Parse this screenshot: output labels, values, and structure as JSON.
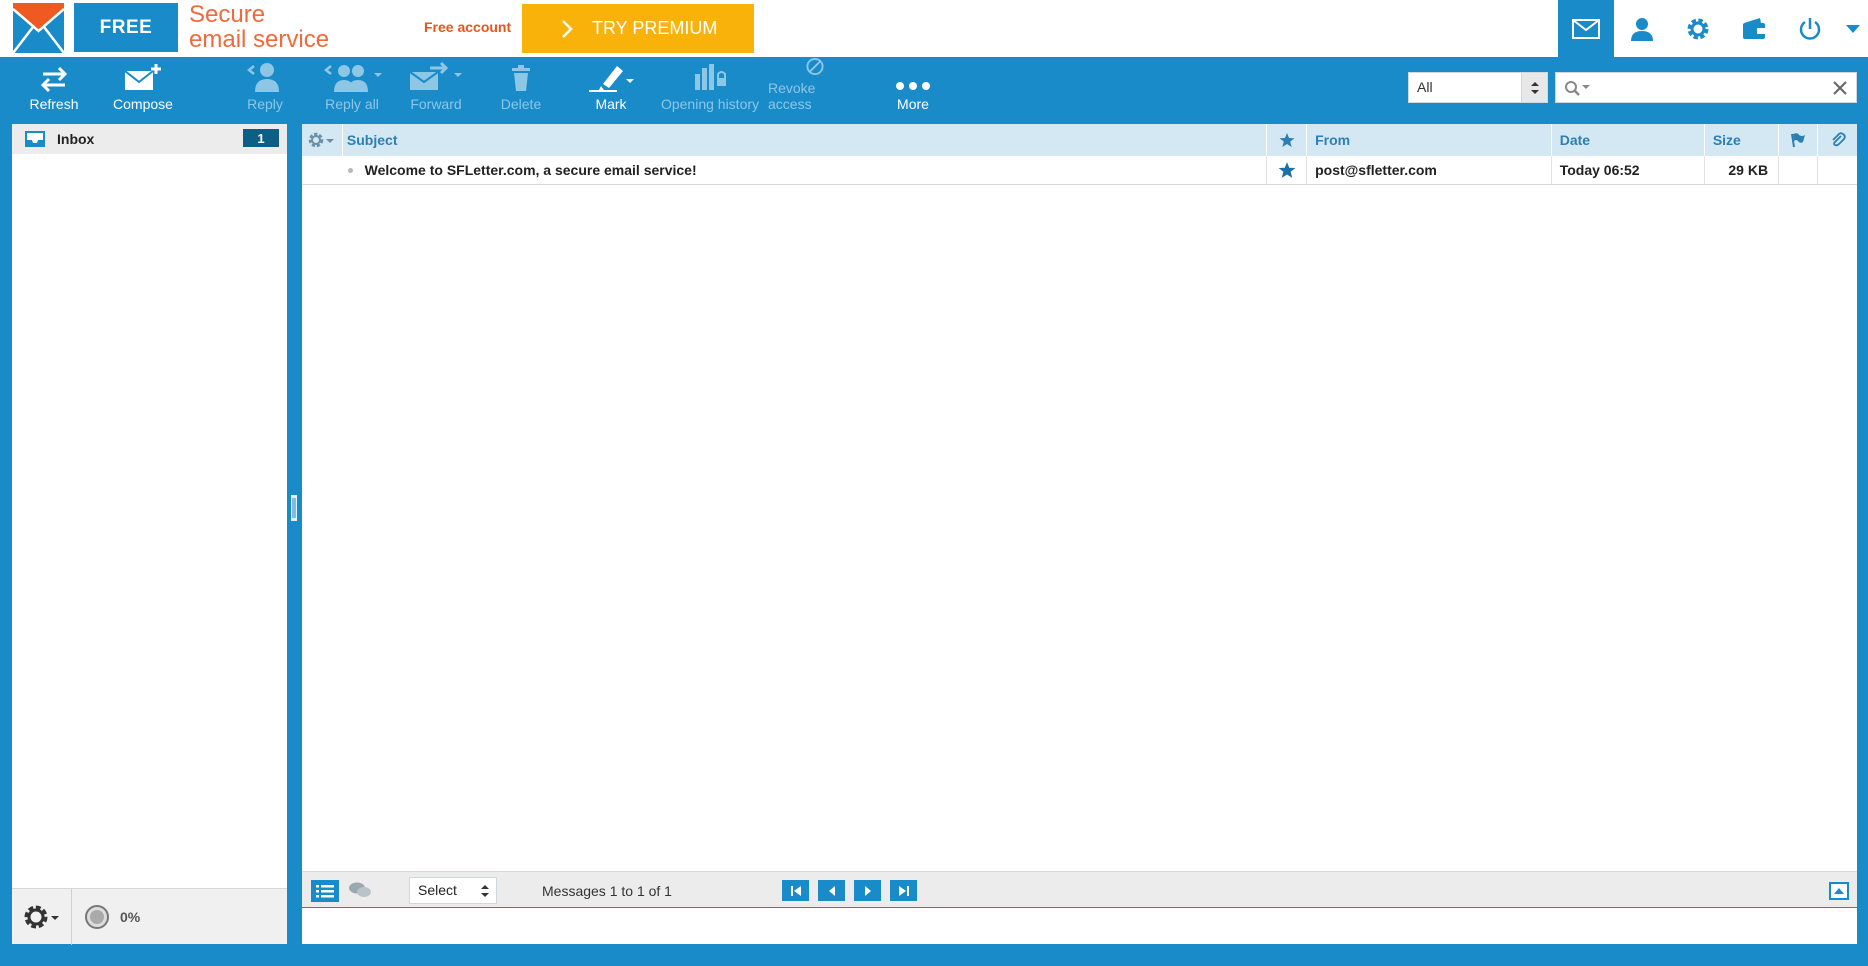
{
  "header": {
    "plan_badge": "FREE",
    "tagline_line1": "Secure",
    "tagline_line2": "email service",
    "account_label": "Free account",
    "premium_button": "TRY PREMIUM",
    "icons": [
      "mail-icon",
      "contacts-icon",
      "settings-icon",
      "wallet-icon",
      "power-icon",
      "chevron-down-icon"
    ]
  },
  "toolbar": {
    "refresh": "Refresh",
    "compose": "Compose",
    "reply": "Reply",
    "reply_all": "Reply all",
    "forward": "Forward",
    "delete": "Delete",
    "mark": "Mark",
    "opening_history": "Opening history",
    "revoke_access": "Revoke access",
    "more": "More",
    "filter_value": "All",
    "search_placeholder": ""
  },
  "sidebar": {
    "folders": [
      {
        "name": "Inbox",
        "unread": "1"
      }
    ],
    "quota": "0%"
  },
  "list": {
    "columns": {
      "subject": "Subject",
      "from": "From",
      "date": "Date",
      "size": "Size"
    },
    "messages": [
      {
        "subject": "Welcome to SFLetter.com, a secure email service!",
        "from": "post@sfletter.com",
        "date": "Today 06:52",
        "size": "29 KB",
        "starred": true,
        "unread": true
      }
    ],
    "select_label": "Select",
    "count_text": "Messages 1 to 1 of 1"
  },
  "colors": {
    "primary": "#1a8bc9",
    "premium": "#f8b20a",
    "brand_orange": "#ef6a3c",
    "header_row": "#d4e8f3"
  }
}
